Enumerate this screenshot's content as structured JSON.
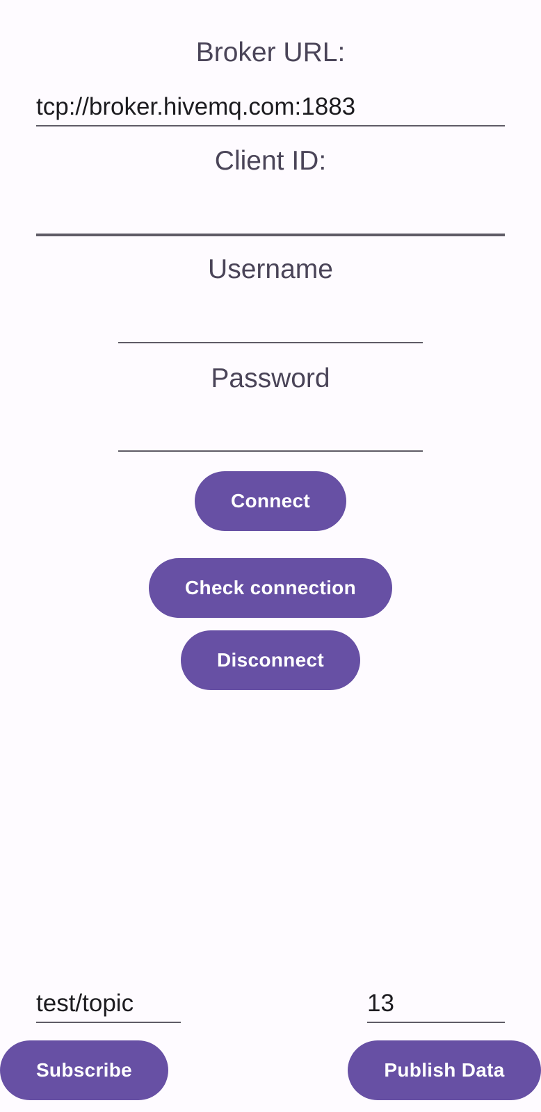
{
  "broker": {
    "label": "Broker URL:",
    "value": "tcp://broker.hivemq.com:1883"
  },
  "client": {
    "label": "Client ID:",
    "value": ""
  },
  "username": {
    "label": "Username",
    "value": ""
  },
  "password": {
    "label": "Password",
    "value": ""
  },
  "buttons": {
    "connect": "Connect",
    "check": "Check connection",
    "disconnect": "Disconnect",
    "subscribe": "Subscribe",
    "publish": "Publish Data"
  },
  "topic": {
    "value": "test/topic"
  },
  "payload": {
    "value": "13"
  },
  "colors": {
    "accent": "#6750a4",
    "background": "#fefbff",
    "label": "#4a4458",
    "underline": "#5f5b66"
  }
}
